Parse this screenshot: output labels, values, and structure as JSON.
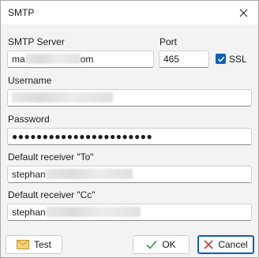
{
  "window": {
    "title": "SMTP"
  },
  "server": {
    "label": "SMTP Server",
    "value_prefix": "ma",
    "value_suffix": "om"
  },
  "port": {
    "label": "Port",
    "value": "465"
  },
  "ssl": {
    "label": "SSL",
    "checked": true
  },
  "username": {
    "label": "Username",
    "value": ""
  },
  "password": {
    "label": "Password",
    "value": "●●●●●●●●●●●●●●●●●●●●●●●"
  },
  "receiver_to": {
    "label": "Default receiver \"To\"",
    "value_prefix": "stephan"
  },
  "receiver_cc": {
    "label": "Default receiver \"Cc\"",
    "value_prefix": "stephan"
  },
  "buttons": {
    "test": "Test",
    "ok": "OK",
    "cancel": "Cancel"
  },
  "icons": {
    "close": "close-icon",
    "test": "envelope-icon",
    "ok": "checkmark-icon",
    "cancel": "x-icon",
    "ssl": "checkbox-check-icon"
  },
  "colors": {
    "accent": "#0f5fb8",
    "ok_green": "#2e9a3a",
    "cancel_red": "#d23b3b"
  }
}
